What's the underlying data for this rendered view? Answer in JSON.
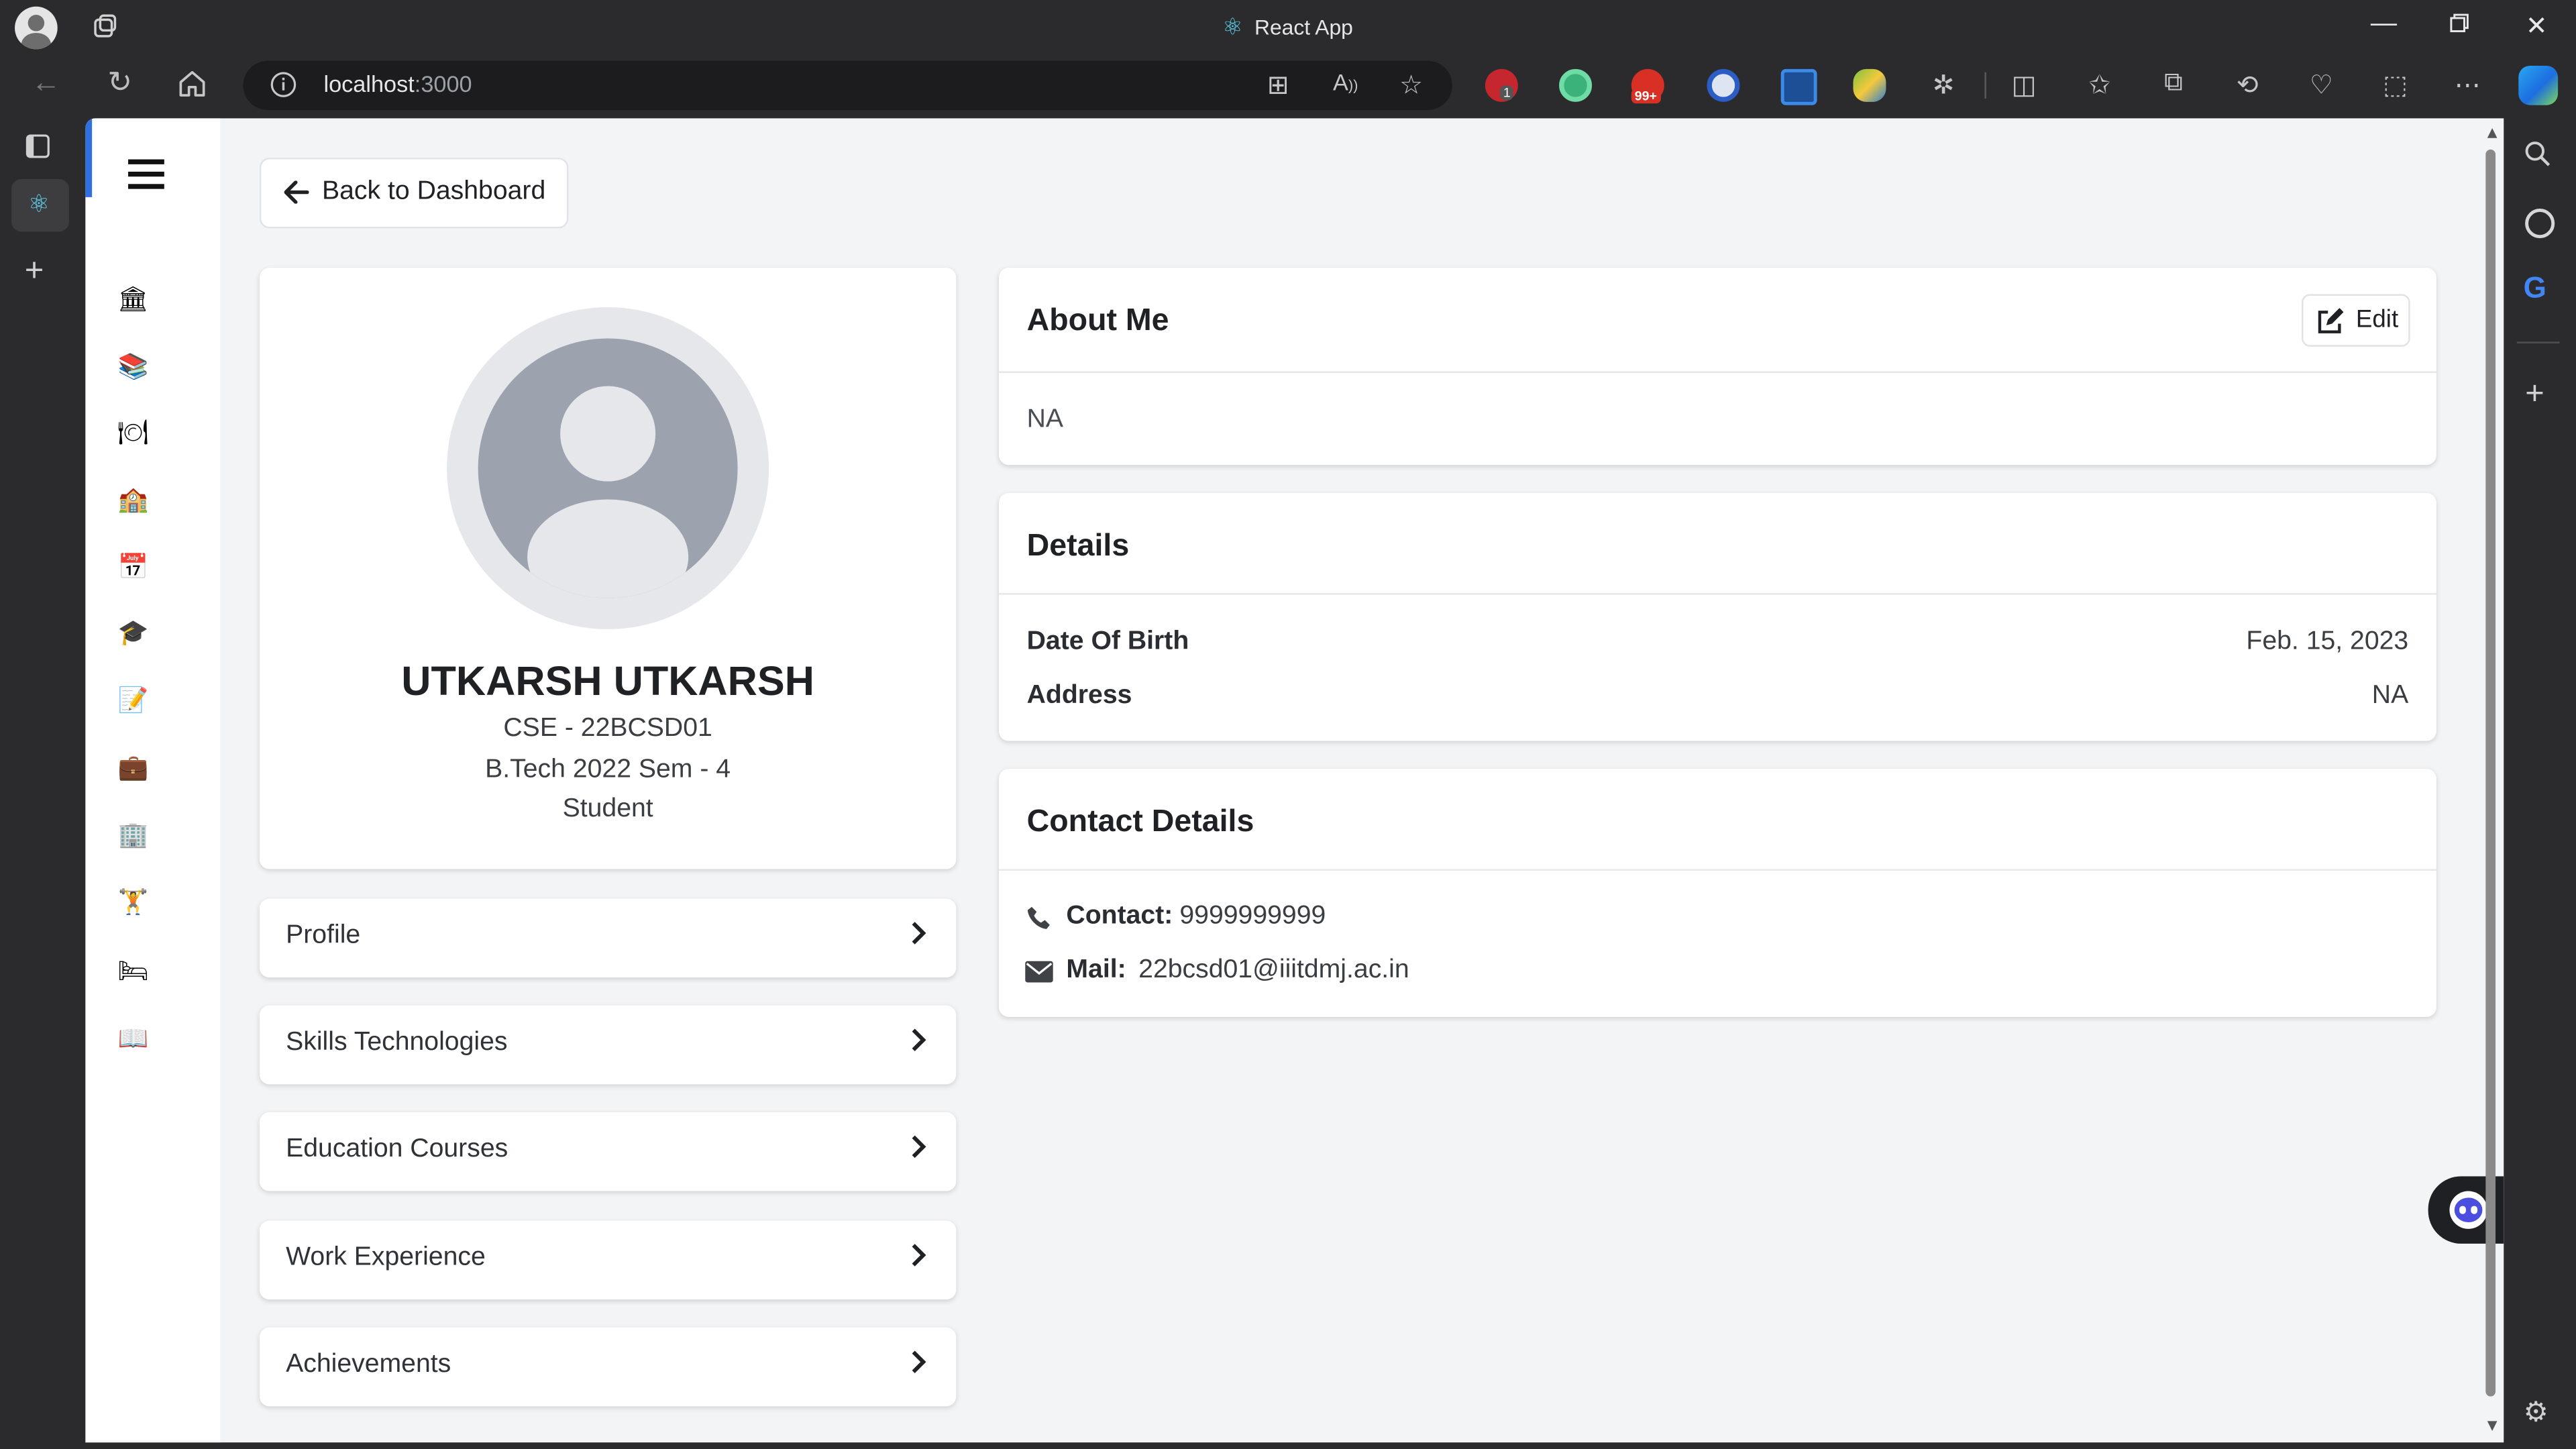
{
  "browser": {
    "window_title": "React App",
    "url_host": "localhost",
    "url_port": ":3000",
    "extension_badges": {
      "ublock": "1",
      "gmail": "99+"
    }
  },
  "app": {
    "back_button_label": "Back to Dashboard",
    "nav_icons": [
      "bank-icon",
      "books-icon",
      "dish-icon",
      "school-icon",
      "calendar-icon",
      "graduation-cap-icon",
      "memo-icon",
      "briefcase-icon",
      "office-building-icon",
      "person-lifting-icon",
      "bed-icon",
      "open-book-icon"
    ],
    "profile": {
      "name": "UTKARSH UTKARSH",
      "dept_roll": "CSE - 22BCSD01",
      "program": "B.Tech 2022 Sem - 4",
      "role": "Student"
    },
    "menu": [
      {
        "label": "Profile"
      },
      {
        "label": "Skills Technologies"
      },
      {
        "label": "Education Courses"
      },
      {
        "label": "Work Experience"
      },
      {
        "label": "Achievements"
      }
    ],
    "about": {
      "title": "About Me",
      "edit_label": "Edit",
      "text": "NA"
    },
    "details": {
      "title": "Details",
      "rows": [
        {
          "label": "Date Of Birth",
          "value": "Feb. 15, 2023"
        },
        {
          "label": "Address",
          "value": "NA"
        }
      ]
    },
    "contact": {
      "title": "Contact Details",
      "phone_label": "Contact:",
      "phone_value": "9999999999",
      "mail_label": "Mail:",
      "mail_value": "22bcsd01@iiitdmj.ac.in"
    }
  },
  "colors": {
    "page_bg": "#f3f4f6",
    "card_bg": "#ffffff",
    "avatar_ring": "#e5e7eb",
    "avatar_fill": "#9ca3af",
    "text_dark": "#1f2124",
    "browser_chrome": "#2b2b2d"
  }
}
